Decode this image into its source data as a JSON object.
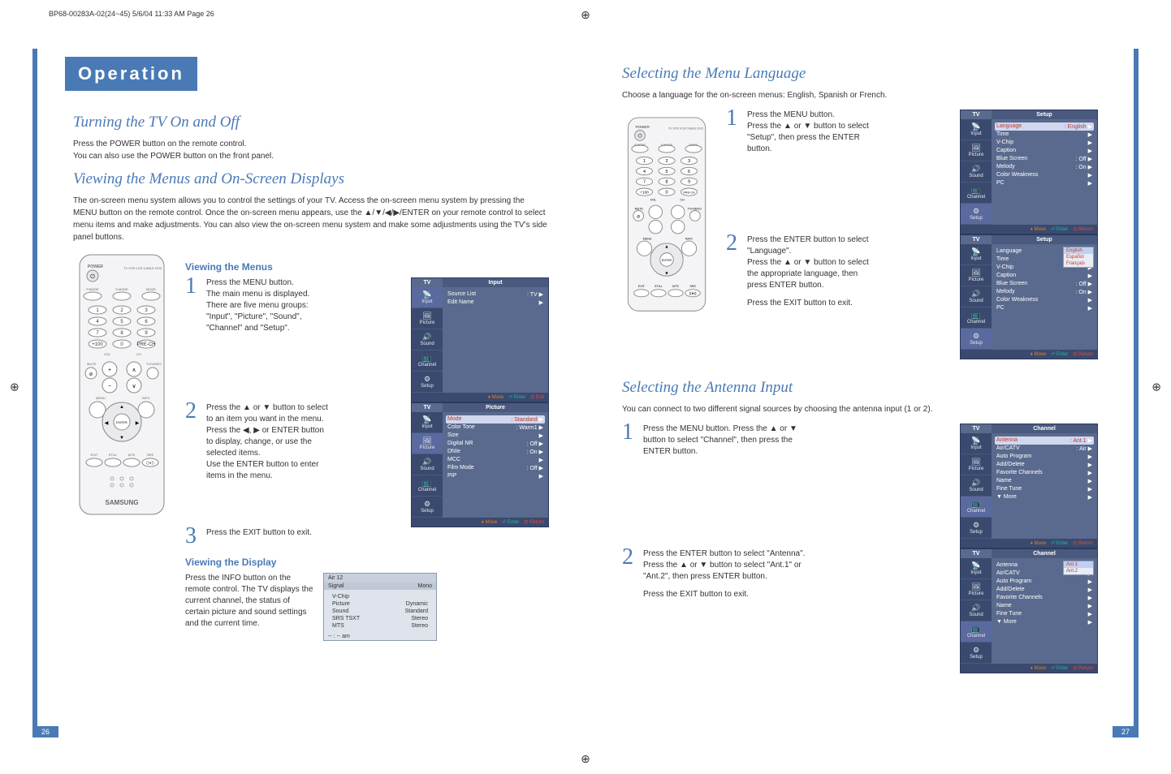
{
  "doc_header": "BP68-00283A-02(24~45)  5/6/04  11:33 AM  Page 26",
  "crop_glyph": "⊕",
  "operation_label": "Operation",
  "page_left_num": "26",
  "page_right_num": "27",
  "left": {
    "h_turning": "Turning the TV On and Off",
    "p_turning": "Press the POWER button on the remote control.\nYou can also use the POWER button on the front panel.",
    "h_viewing_menus": "Viewing the Menus and On-Screen Displays",
    "p_viewing_menus": "The on-screen menu system allows you to control the settings of your TV. Access the on-screen menu system by pressing the MENU button on the remote control. Once the on-screen menu appears, use the ▲/▼/◀/▶/ENTER on your remote control to select menu items and make adjustments. You can also view the on-screen menu system and make some adjustments using the TV's side panel buttons.",
    "sub_viewing_menus": "Viewing the Menus",
    "step1": "Press the MENU button.\nThe main menu is displayed.\nThere are five menu groups: \"Input\", \"Picture\", \"Sound\", \"Channel\" and \"Setup\".",
    "step2": "Press the ▲ or ▼ button to select to an item you want in the menu.\nPress the ◀, ▶ or ENTER button to display, change, or use the selected items.\nUse the ENTER button to enter items in the menu.",
    "step3": "Press the EXIT button to exit.",
    "sub_viewing_display": "Viewing the Display",
    "p_viewing_display": "Press the INFO button on the remote control.\nThe TV displays the current channel, the status of certain picture and sound settings and the current time.",
    "remote_brand": "SAMSUNG",
    "remote_labels": {
      "power": "POWER",
      "mode_row": "TV  STB  VCR  CABLE  DVD",
      "pmode": "P.MODE",
      "smode": "S.MODE",
      "mode": "MODE",
      "mute": "MUTE",
      "vol": "VOL",
      "ch": "CH",
      "tvvideo": "TV/VIDEO",
      "menu": "MENU",
      "info": "INFO",
      "enter": "ENTER",
      "pip": "EXIT",
      "still": "STILL",
      "mts": "MTS",
      "srs": "SRS"
    },
    "menu_input": {
      "tv": "TV",
      "title": "Input",
      "tabs": [
        "Input",
        "Picture",
        "Sound",
        "Channel",
        "Setup"
      ],
      "items": [
        {
          "l": "Source List",
          "v": ": TV"
        },
        {
          "l": "Edit Name",
          "v": ""
        }
      ],
      "footer": {
        "move": "Move",
        "enter": "Enter",
        "exit": "Exit"
      }
    },
    "menu_picture": {
      "tv": "TV",
      "title": "Picture",
      "tabs": [
        "Input",
        "Picture",
        "Sound",
        "Channel",
        "Setup"
      ],
      "items": [
        {
          "l": "Mode",
          "v": ": Standard",
          "sel": true
        },
        {
          "l": "Color Tone",
          "v": ": Warm1"
        },
        {
          "l": "Size",
          "v": ""
        },
        {
          "l": "Digital NR",
          "v": ": Off"
        },
        {
          "l": "DNIe",
          "v": ": On"
        },
        {
          "l": "MCC",
          "v": ""
        },
        {
          "l": "Film Mode",
          "v": ": Off"
        },
        {
          "l": "PIP",
          "v": ""
        }
      ],
      "footer": {
        "move": "Move",
        "enter": "Enter",
        "exit": "Return"
      }
    },
    "info_box": {
      "air": "Air 12",
      "signal": "Signal",
      "mono": "Mono",
      "rows": [
        {
          "l": "V-Chip",
          "v": ""
        },
        {
          "l": "Picture",
          "v": "Dynamic"
        },
        {
          "l": "Sound",
          "v": "Standard"
        },
        {
          "l": "SRS TSXT",
          "v": "Stereo"
        },
        {
          "l": "MTS",
          "v": "Stereo"
        }
      ],
      "time": "-- : --  am"
    }
  },
  "right": {
    "h_lang": "Selecting the Menu Language",
    "p_lang": "Choose a language for the on-screen menus: English, Spanish or French.",
    "lang_step1": "Press the MENU button.\nPress the ▲ or ▼ button to select \"Setup\", then press the ENTER button.",
    "lang_step2": "Press the ENTER button to select \"Language\".\nPress the ▲ or ▼ button to select the appropriate language, then press ENTER button.",
    "lang_exit": "Press the EXIT button to exit.",
    "menu_setup1": {
      "tv": "TV",
      "title": "Setup",
      "tabs": [
        "Input",
        "Picture",
        "Sound",
        "Channel",
        "Setup"
      ],
      "items": [
        {
          "l": "Language",
          "v": ": English",
          "sel": true
        },
        {
          "l": "Time",
          "v": ""
        },
        {
          "l": "V-Chip",
          "v": ""
        },
        {
          "l": "Caption",
          "v": ""
        },
        {
          "l": "Blue Screen",
          "v": ": Off"
        },
        {
          "l": "Melody",
          "v": ": On"
        },
        {
          "l": "Color Weakness",
          "v": ""
        },
        {
          "l": "PC",
          "v": ""
        }
      ],
      "footer": {
        "move": "Move",
        "enter": "Enter",
        "exit": "Return"
      }
    },
    "menu_setup2": {
      "tv": "TV",
      "title": "Setup",
      "tabs": [
        "Input",
        "Picture",
        "Sound",
        "Channel",
        "Setup"
      ],
      "items": [
        {
          "l": "Language",
          "v": ""
        },
        {
          "l": "Time",
          "v": ""
        },
        {
          "l": "V-Chip",
          "v": ""
        },
        {
          "l": "Caption",
          "v": ""
        },
        {
          "l": "Blue Screen",
          "v": ": Off"
        },
        {
          "l": "Melody",
          "v": ": On"
        },
        {
          "l": "Color Weakness",
          "v": ""
        },
        {
          "l": "PC",
          "v": ""
        }
      ],
      "lang_opts": [
        "English",
        "Español",
        "Français"
      ],
      "footer": {
        "move": "Move",
        "enter": "Enter",
        "exit": "Return"
      }
    },
    "h_antenna": "Selecting the Antenna Input",
    "p_antenna": "You can connect to two different signal sources by choosing the antenna input (1 or 2).",
    "ant_step1": "Press the MENU button.\nPress the ▲ or ▼ button to select \"Channel\", then press the ENTER button.",
    "ant_step2": "Press the ENTER button to select \"Antenna\".\nPress the ▲ or ▼ button to select \"Ant.1\" or \"Ant.2\", then press ENTER button.",
    "ant_exit": "Press the EXIT button to exit.",
    "menu_channel1": {
      "tv": "TV",
      "title": "Channel",
      "tabs": [
        "Input",
        "Picture",
        "Sound",
        "Channel",
        "Setup"
      ],
      "items": [
        {
          "l": "Antenna",
          "v": ": Ant.1",
          "sel": true
        },
        {
          "l": "Air/CATV",
          "v": ": Air"
        },
        {
          "l": "Auto Program",
          "v": ""
        },
        {
          "l": "Add/Delete",
          "v": ""
        },
        {
          "l": "Favorite Channels",
          "v": ""
        },
        {
          "l": "Name",
          "v": ""
        },
        {
          "l": "Fine Tune",
          "v": ""
        },
        {
          "l": "▼ More",
          "v": ""
        }
      ],
      "footer": {
        "move": "Move",
        "enter": "Enter",
        "exit": "Return"
      }
    },
    "menu_channel2": {
      "tv": "TV",
      "title": "Channel",
      "tabs": [
        "Input",
        "Picture",
        "Sound",
        "Channel",
        "Setup"
      ],
      "items": [
        {
          "l": "Antenna",
          "v": ""
        },
        {
          "l": "Air/CATV",
          "v": ""
        },
        {
          "l": "Auto Program",
          "v": ""
        },
        {
          "l": "Add/Delete",
          "v": ""
        },
        {
          "l": "Favorite Channels",
          "v": ""
        },
        {
          "l": "Name",
          "v": ""
        },
        {
          "l": "Fine Tune",
          "v": ""
        },
        {
          "l": "▼ More",
          "v": ""
        }
      ],
      "ant_opts": [
        "Ant.1",
        "Ant.2"
      ],
      "footer": {
        "move": "Move",
        "enter": "Enter",
        "exit": "Return"
      }
    }
  }
}
